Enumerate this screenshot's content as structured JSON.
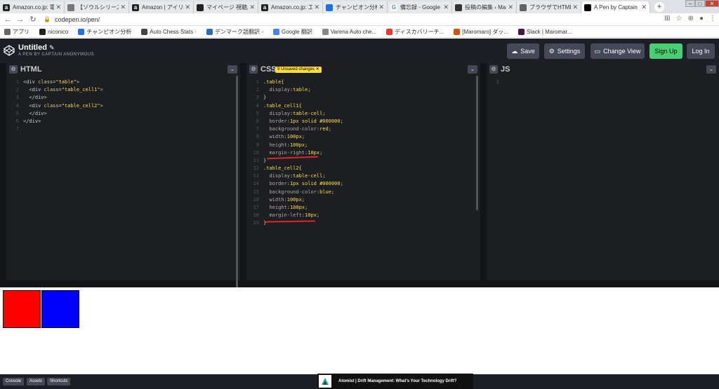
{
  "browser": {
    "tabs": [
      {
        "label": "Amazon.co.jp: 電",
        "icon": "a",
        "color": "#222"
      },
      {
        "label": "【ソウルシリーズ",
        "icon": "ghost",
        "color": "#666"
      },
      {
        "label": "Amazon | アイリ",
        "icon": "a",
        "color": "#222"
      },
      {
        "label": "マイページ 視聴履",
        "icon": "tv",
        "color": "#222"
      },
      {
        "label": "Amazon.co.jp: 工",
        "icon": "a",
        "color": "#222"
      },
      {
        "label": "チャンピオン分析",
        "icon": "bar",
        "color": "#1a73e8"
      },
      {
        "label": "備忘録 - Google 検",
        "icon": "G",
        "color": "#4285f4"
      },
      {
        "label": "投稿の編集 ‹ Maro",
        "icon": "pen",
        "color": "#333"
      },
      {
        "label": "ブラウザでHTML",
        "icon": "doc",
        "color": "#555"
      },
      {
        "label": "A Pen by Captain",
        "icon": "cp",
        "color": "#000"
      }
    ],
    "active_tab": 9,
    "url": "codepen.io/pen/",
    "bookmarks": [
      {
        "label": "アプリ",
        "color": "#666"
      },
      {
        "label": "niconico",
        "color": "#222"
      },
      {
        "label": "チャンピオン分析",
        "color": "#1a73e8"
      },
      {
        "label": "Auto Chess Stats ·",
        "color": "#444"
      },
      {
        "label": "デンマーク語翻訳 -",
        "color": "#2a6ebb"
      },
      {
        "label": "Google 翻訳",
        "color": "#4285f4"
      },
      {
        "label": "Varena Auto che...",
        "color": "#888"
      },
      {
        "label": "ディスカバリーチ...",
        "color": "#e53935"
      },
      {
        "label": "[Maromaro] ダッ...",
        "color": "#d35400"
      },
      {
        "label": "Slack | Maromar...",
        "color": "#4a154b"
      }
    ]
  },
  "codepen": {
    "title": "Untitled",
    "subtitle": "A PEN BY CAPTAIN ANONYMOUS",
    "buttons": {
      "save": "Save",
      "settings": "Settings",
      "change_view": "Change View",
      "sign_up": "Sign Up",
      "log_in": "Log In"
    },
    "panels": {
      "html": "HTML",
      "css": "CSS",
      "js": "JS"
    },
    "unsaved_badge": "9 Unsaved changes ✕",
    "html_code": [
      "<div class=\"table\">",
      "  <div class=\"table_cell1\">",
      "  </div>",
      "  <div class=\"table_cell2\">",
      "  </div>",
      "</div>",
      ""
    ],
    "css_code": [
      ".table{",
      "  display:table;",
      "}",
      ".table_cell1{",
      "  display:table-cell;",
      "  border:1px solid #000000;",
      "  background-color:red;",
      "  width:100px;",
      "  height:100px;",
      "  margin-right:10px;",
      "}",
      ".table_cell2{",
      "  display:table-cell;",
      "  border:1px solid #000000;",
      "  background-color:blue;",
      "  width:100px;",
      "  height:100px;",
      "  margin-left:10px;",
      "}"
    ],
    "js_code": [
      ""
    ],
    "preview_colors": {
      "cell1": "#ff0000",
      "cell2": "#0000ff"
    },
    "footer": {
      "console": "Console",
      "assets": "Assets",
      "shortcuts": "Shortcuts"
    },
    "ad_text": "Atomist | Drift Management: What's Your Technology Drift?"
  }
}
